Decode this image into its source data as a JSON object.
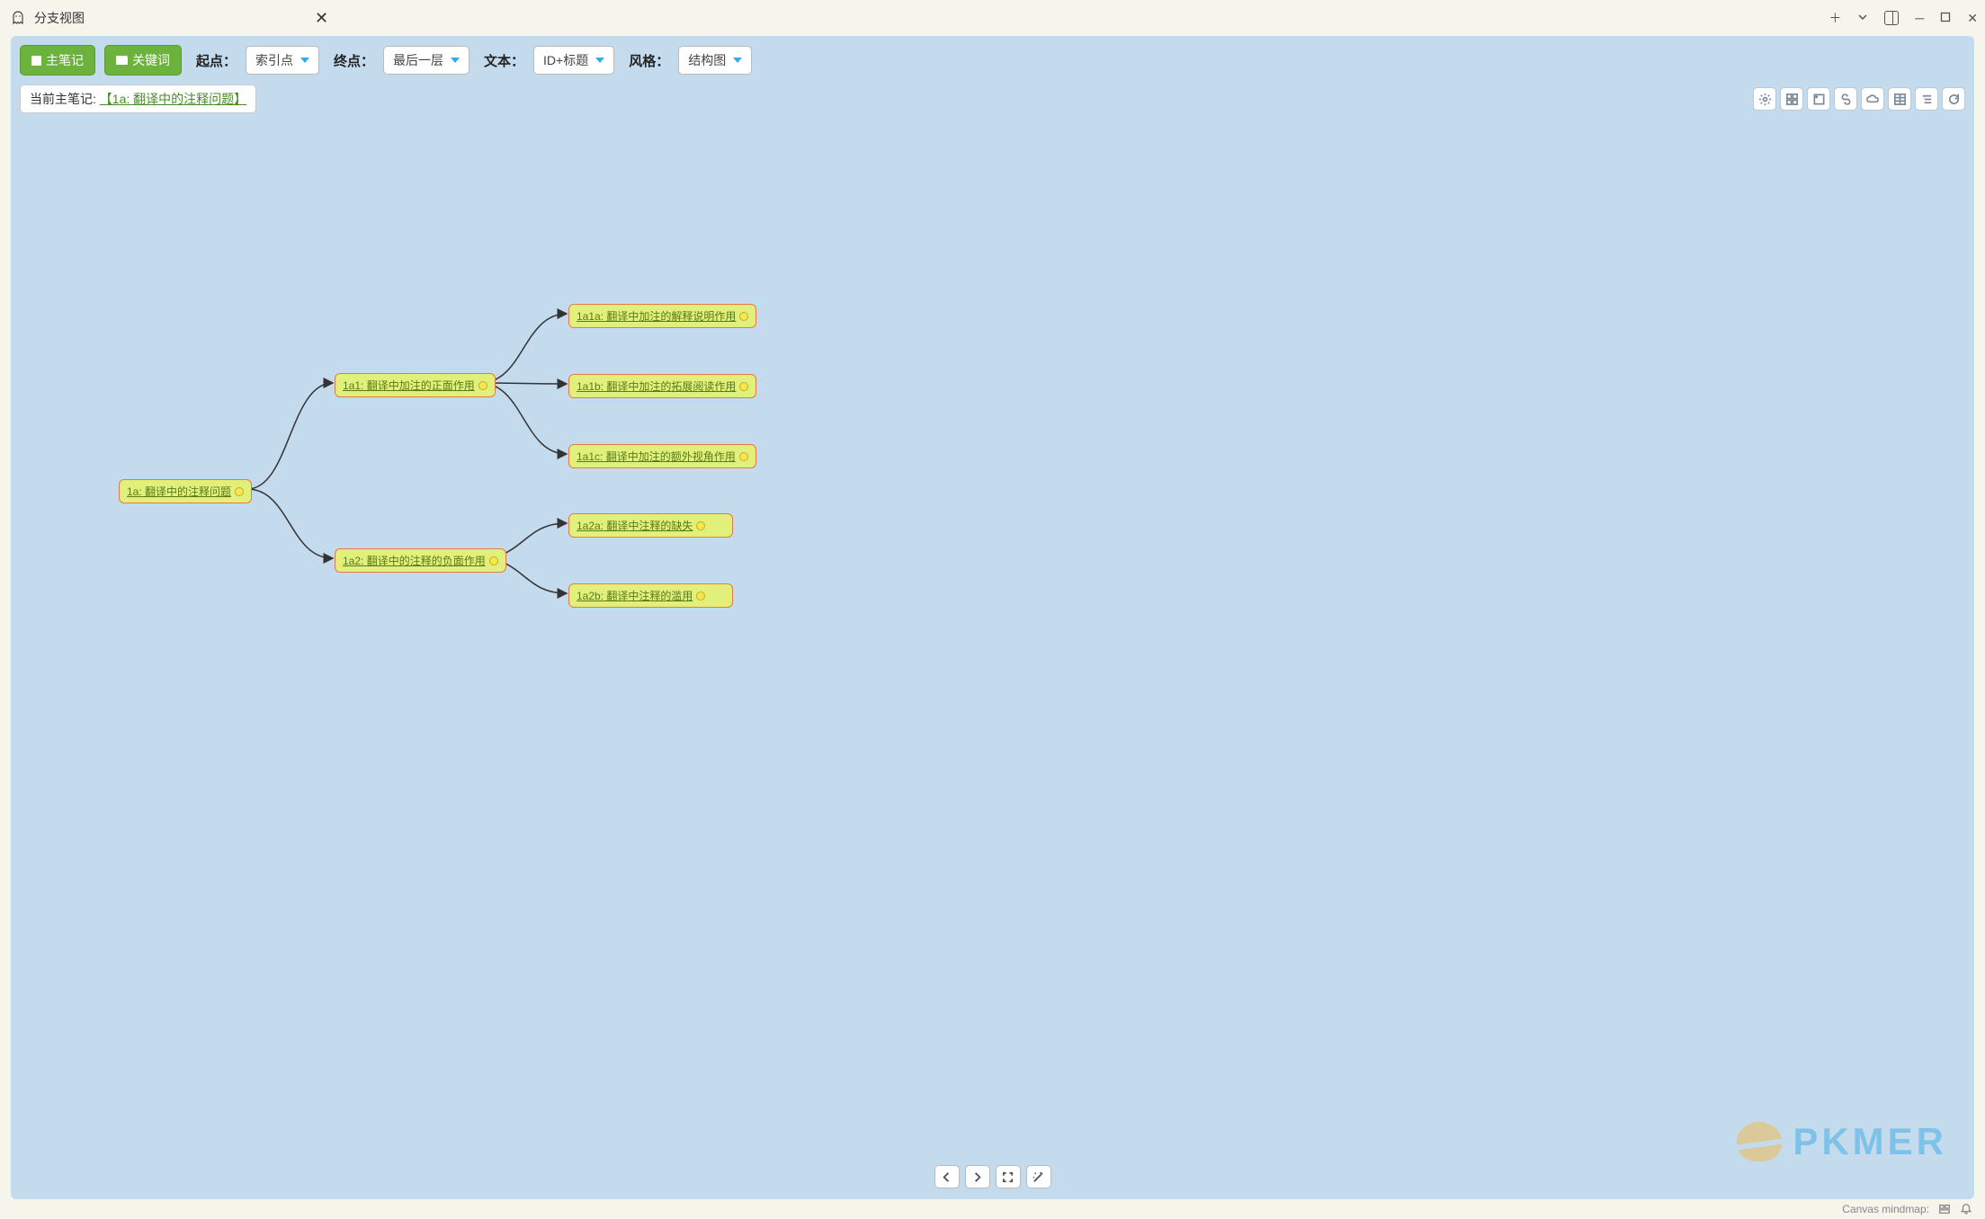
{
  "window": {
    "tab_title": "分支视图"
  },
  "toolbar": {
    "btn_main": "主笔记",
    "btn_keyword": "关键词",
    "label_start": "起点：",
    "dd_start": "索引点",
    "label_end": "终点：",
    "dd_end": "最后一层",
    "label_text": "文本：",
    "dd_text": "ID+标题",
    "label_style": "风格：",
    "dd_style": "结构图"
  },
  "current": {
    "label": "当前主笔记: ",
    "link": "【1a: 翻译中的注释问题】"
  },
  "nodes": {
    "root": "1a: 翻译中的注释问题",
    "n1a1": "1a1: 翻译中加注的正面作用",
    "n1a2": "1a2: 翻译中的注释的负面作用",
    "n1a1a": "1a1a: 翻译中加注的解释说明作用",
    "n1a1b": "1a1b: 翻译中加注的拓展阅读作用",
    "n1a1c": "1a1c: 翻译中加注的额外视角作用",
    "n1a2a": "1a2a: 翻译中注释的缺失",
    "n1a2b": "1a2b: 翻译中注释的滥用"
  },
  "watermark": "PKMER",
  "status": {
    "label": "Canvas mindmap:"
  }
}
